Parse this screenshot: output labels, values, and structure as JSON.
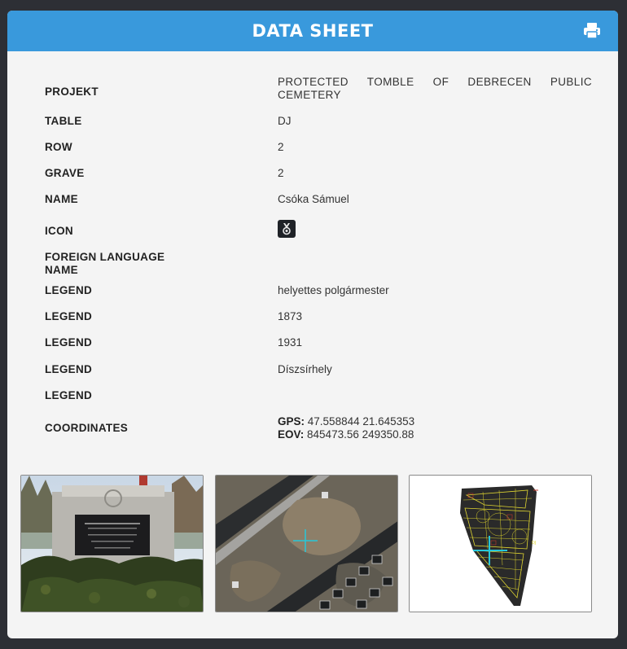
{
  "header": {
    "title": "DATA SHEET",
    "print_icon": "print-icon"
  },
  "fields": {
    "projekt": {
      "label": "PROJEKT",
      "value": "PROTECTED TOMBLE OF DEBRECEN PUBLIC CEMETERY"
    },
    "table": {
      "label": "TABLE",
      "value": "DJ"
    },
    "row": {
      "label": "ROW",
      "value": "2"
    },
    "grave": {
      "label": "GRAVE",
      "value": "2"
    },
    "name": {
      "label": "NAME",
      "value": "Csóka Sámuel"
    },
    "icon": {
      "label": "ICON",
      "icon_name": "medal-icon"
    },
    "foreign_name": {
      "label": "FOREIGN LANGUAGE NAME",
      "value": ""
    },
    "legend_1": {
      "label": "LEGEND",
      "value": "helyettes polgármester"
    },
    "legend_2": {
      "label": "LEGEND",
      "value": "1873"
    },
    "legend_3": {
      "label": "LEGEND",
      "value": "1931"
    },
    "legend_4": {
      "label": "LEGEND",
      "value": "Díszsírhely"
    },
    "legend_5": {
      "label": "LEGEND",
      "value": ""
    },
    "coordinates": {
      "label": "COORDINATES",
      "gps_label": "GPS:",
      "gps_value": "47.558844 21.645353",
      "eov_label": "EOV:",
      "eov_value": "845473.56 249350.88"
    }
  },
  "colors": {
    "header": "#3999dc",
    "card": "#f4f4f4",
    "background": "#2d2f35"
  },
  "gallery": [
    {
      "name": "grave-photo"
    },
    {
      "name": "aerial-photo"
    },
    {
      "name": "cemetery-map"
    }
  ]
}
